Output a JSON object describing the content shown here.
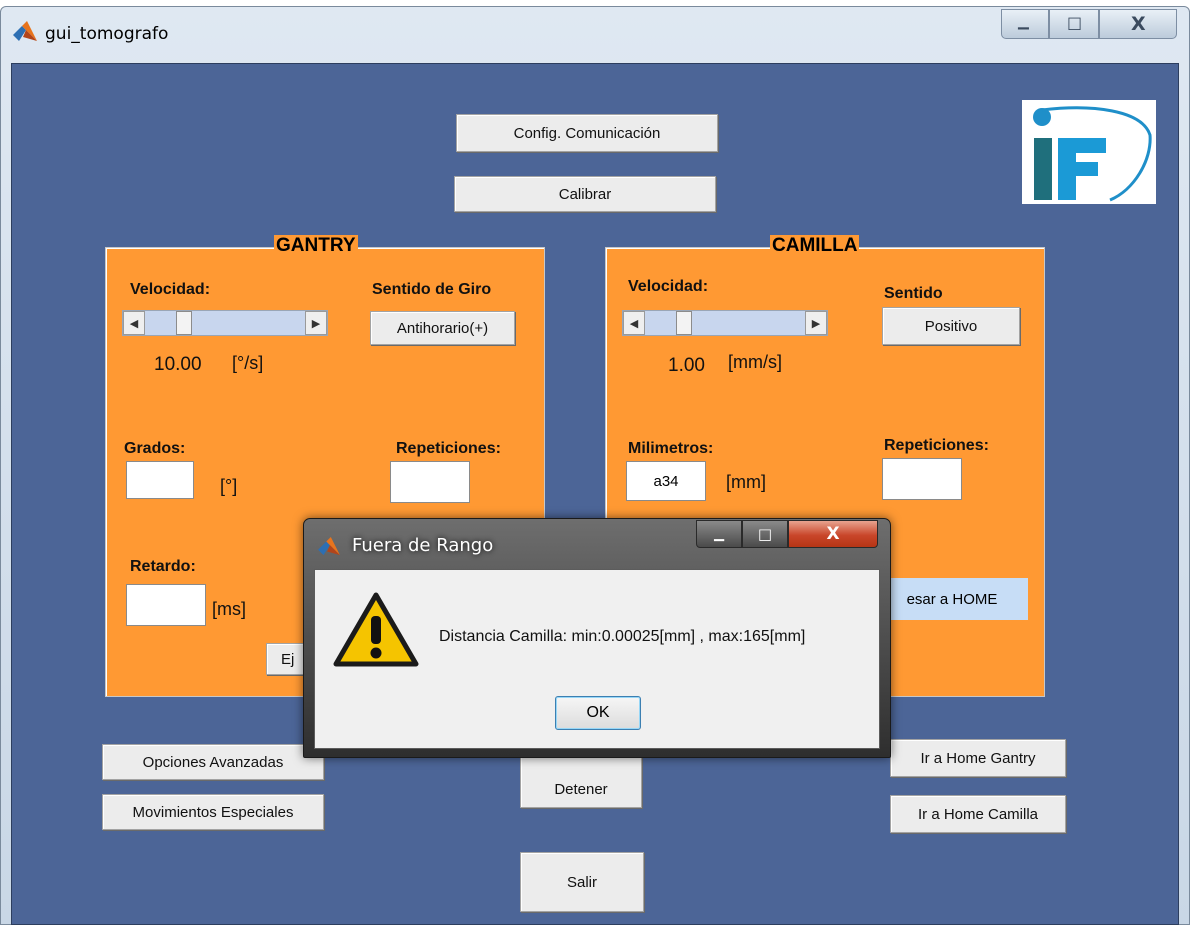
{
  "window": {
    "title": "gui_tomografo",
    "minimize_glyph": "▁",
    "maximize_glyph": "□",
    "close_glyph": "X"
  },
  "colors": {
    "background": "#4c6597",
    "panel": "#ff9933",
    "logo_blue": "#1b9ad6",
    "logo_teal": "#1f6f7c"
  },
  "toolbar": {
    "config_label": "Config. Comunicación",
    "calibrar_label": "Calibrar"
  },
  "gantry": {
    "title": "GANTRY",
    "velocidad_label": "Velocidad:",
    "sentido_label": "Sentido de Giro",
    "sentido_button": "Antihorario(+)",
    "speed_value": "10.00",
    "speed_unit": "[°/s]",
    "slider_position": 0.3,
    "grados_label": "Grados:",
    "grados_value": "",
    "grados_unit": "[°]",
    "repeticiones_label": "Repeticiones:",
    "repeticiones_value": "",
    "retardo_label": "Retardo:",
    "retardo_value": "",
    "retardo_unit": "[ms]",
    "ejecutar_label": "Ej"
  },
  "camilla": {
    "title": "CAMILLA",
    "velocidad_label": "Velocidad:",
    "sentido_label": "Sentido",
    "sentido_button": "Positivo",
    "speed_value": "1.00",
    "speed_unit": "[mm/s]",
    "slider_position": 0.3,
    "milimetros_label": "Milimetros:",
    "milimetros_value": "a34",
    "milimetros_unit": "[mm]",
    "repeticiones_label": "Repeticiones:",
    "repeticiones_value": "",
    "home_label": "esar a HOME"
  },
  "bottom": {
    "opciones_label": "Opciones Avanzadas",
    "movimientos_label": "Movimientos Especiales",
    "detener_label": "Detener",
    "home_gantry_label": "Ir a Home Gantry",
    "home_camilla_label": "Ir a Home Camilla",
    "salir_label": "Salir"
  },
  "dialog": {
    "title": "Fuera de Rango",
    "message": "Distancia Camilla: min:0.00025[mm] , max:165[mm]",
    "ok_label": "OK",
    "icon": "warning-icon"
  }
}
